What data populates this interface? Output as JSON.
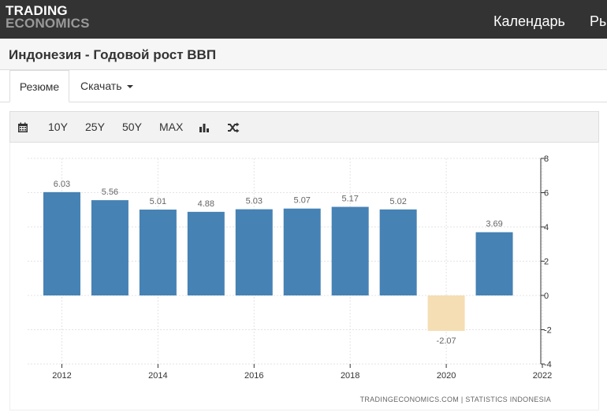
{
  "header": {
    "logo_line1": "TRADING",
    "logo_line2": "ECONOMICS",
    "nav": [
      "Календарь",
      "Рынки"
    ]
  },
  "page_title": "Индонезия - Годовой рост ВВП",
  "tabs": {
    "summary": "Резюме",
    "download": "Скачать"
  },
  "toolbar": {
    "ranges": [
      "10Y",
      "25Y",
      "50Y",
      "MAX"
    ]
  },
  "icons": [
    "calendar-icon",
    "bar-chart-icon",
    "shuffle-icon",
    "caret-down-icon"
  ],
  "colors": {
    "positive_bar": "#4682b4",
    "negative_bar": "#f5deb3",
    "header_bg": "#333333"
  },
  "source_note": "TRADINGECONOMICS.COM | STATISTICS INDONESIA",
  "chart_data": {
    "type": "bar",
    "categories": [
      "2012",
      "2013",
      "2014",
      "2015",
      "2016",
      "2017",
      "2018",
      "2019",
      "2020",
      "2021"
    ],
    "values": [
      6.03,
      5.56,
      5.01,
      4.88,
      5.03,
      5.07,
      5.17,
      5.02,
      -2.07,
      3.69
    ],
    "data_labels": [
      "6.03",
      "5.56",
      "5.01",
      "4.88",
      "5.03",
      "5.07",
      "5.17",
      "5.02",
      "-2.07",
      "3.69"
    ],
    "x_tick_labels": [
      "2012",
      "2014",
      "2016",
      "2018",
      "2020",
      "2022"
    ],
    "y_tick_labels": [
      "8",
      "6",
      "4",
      "2",
      "0",
      "-2",
      "-4"
    ],
    "ylim": [
      -4,
      8
    ],
    "grid": true,
    "y_axis_position": "right",
    "title": "",
    "xlabel": "",
    "ylabel": ""
  }
}
